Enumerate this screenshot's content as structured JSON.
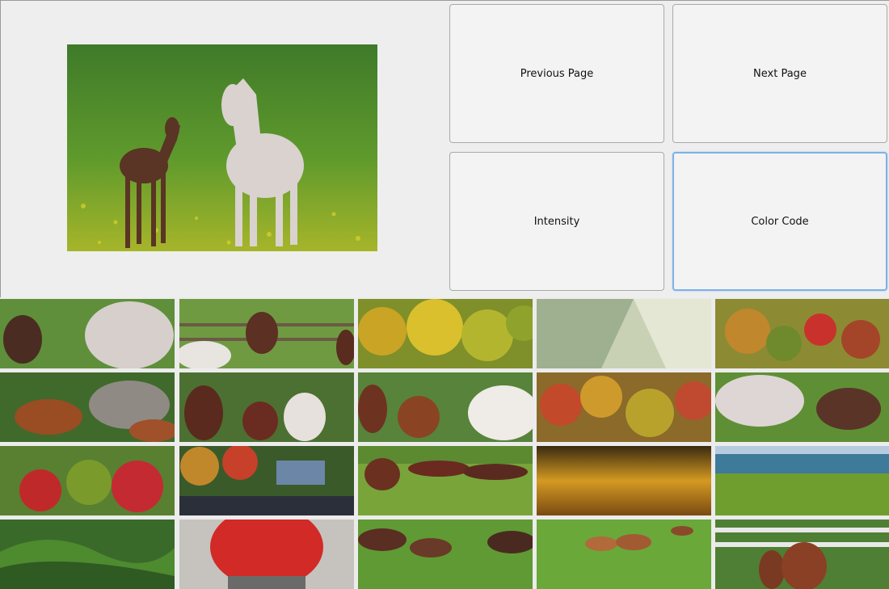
{
  "buttons": {
    "previous": "Previous Page",
    "next": "Next Page",
    "intensity": "Intensity",
    "color_code": "Color Code"
  },
  "focused_button": "color_code",
  "preview": {
    "subject": "white mare and brown foal in green field"
  },
  "thumbnails": [
    {
      "subject": "foal and white horse"
    },
    {
      "subject": "horses at wooden fence"
    },
    {
      "subject": "autumn yellow trees"
    },
    {
      "subject": "pale green abstract"
    },
    {
      "subject": "autumn foliage hillside"
    },
    {
      "subject": "chestnut horse by rock"
    },
    {
      "subject": "horses under tree"
    },
    {
      "subject": "horses in pasture"
    },
    {
      "subject": "autumn forest colors"
    },
    {
      "subject": "white horse and foal"
    },
    {
      "subject": "red autumn bushes"
    },
    {
      "subject": "lake cabin autumn"
    },
    {
      "subject": "cattle drive rider"
    },
    {
      "subject": "orange sunset clouds"
    },
    {
      "subject": "seaside green lawn"
    },
    {
      "subject": "rolling green hills"
    },
    {
      "subject": "red object closeup"
    },
    {
      "subject": "cattle herd on grass"
    },
    {
      "subject": "calves in meadow"
    },
    {
      "subject": "mare and foal at fence"
    }
  ]
}
